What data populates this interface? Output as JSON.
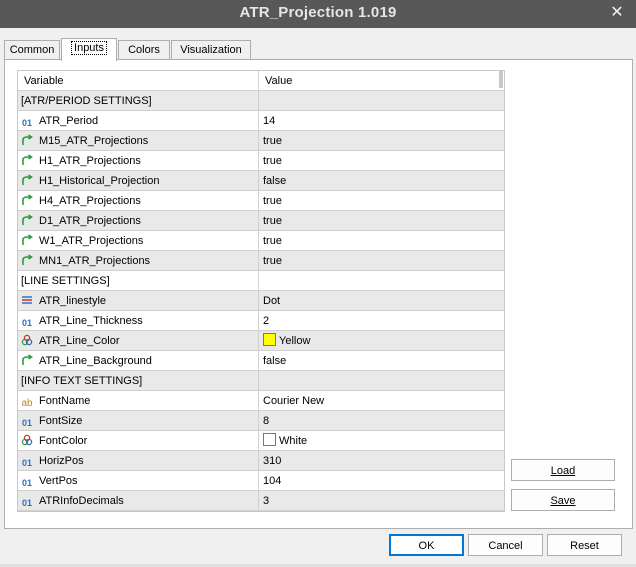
{
  "window": {
    "title": "ATR_Projection 1.019",
    "close_label": "✕"
  },
  "tabs": [
    {
      "label": "Common"
    },
    {
      "label": "Inputs"
    },
    {
      "label": "Colors"
    },
    {
      "label": "Visualization"
    }
  ],
  "grid": {
    "col_variable": "Variable",
    "col_value": "Value",
    "rows": [
      {
        "type": "section",
        "variable": "[ATR/PERIOD SETTINGS]",
        "value": ""
      },
      {
        "type": "int",
        "icon": "integer-icon",
        "variable": "ATR_Period",
        "value": "14"
      },
      {
        "type": "bool",
        "icon": "boolean-icon",
        "variable": "M15_ATR_Projections",
        "value": "true"
      },
      {
        "type": "bool",
        "icon": "boolean-icon",
        "variable": "H1_ATR_Projections",
        "value": "true"
      },
      {
        "type": "bool",
        "icon": "boolean-icon",
        "variable": "H1_Historical_Projection",
        "value": "false"
      },
      {
        "type": "bool",
        "icon": "boolean-icon",
        "variable": "H4_ATR_Projections",
        "value": "true"
      },
      {
        "type": "bool",
        "icon": "boolean-icon",
        "variable": "D1_ATR_Projections",
        "value": "true"
      },
      {
        "type": "bool",
        "icon": "boolean-icon",
        "variable": "W1_ATR_Projections",
        "value": "true"
      },
      {
        "type": "bool",
        "icon": "boolean-icon",
        "variable": "MN1_ATR_Projections",
        "value": "true"
      },
      {
        "type": "section",
        "variable": "[LINE SETTINGS]",
        "value": ""
      },
      {
        "type": "enum",
        "icon": "line-style-icon",
        "variable": "ATR_linestyle",
        "value": "Dot"
      },
      {
        "type": "int",
        "icon": "integer-icon",
        "variable": "ATR_Line_Thickness",
        "value": "2"
      },
      {
        "type": "color",
        "icon": "color-icon",
        "variable": "ATR_Line_Color",
        "value": "Yellow",
        "swatch": "#ffff00"
      },
      {
        "type": "bool",
        "icon": "boolean-icon",
        "variable": "ATR_Line_Background",
        "value": "false"
      },
      {
        "type": "section",
        "variable": "[INFO TEXT SETTINGS]",
        "value": ""
      },
      {
        "type": "string",
        "icon": "string-icon",
        "variable": "FontName",
        "value": "Courier New"
      },
      {
        "type": "int",
        "icon": "integer-icon",
        "variable": "FontSize",
        "value": "8"
      },
      {
        "type": "color",
        "icon": "color-icon",
        "variable": "FontColor",
        "value": "White",
        "swatch": "#ffffff"
      },
      {
        "type": "int",
        "icon": "integer-icon",
        "variable": "HorizPos",
        "value": "310"
      },
      {
        "type": "int",
        "icon": "integer-icon",
        "variable": "VertPos",
        "value": "104"
      },
      {
        "type": "int",
        "icon": "integer-icon",
        "variable": "ATRInfoDecimals",
        "value": "3"
      }
    ]
  },
  "side_buttons": {
    "load": "Load",
    "save": "Save"
  },
  "footer_buttons": {
    "ok": "OK",
    "cancel": "Cancel",
    "reset": "Reset"
  },
  "colors": {
    "titlebar": "#585858",
    "accent": "#0078d7",
    "row_alt": "#e9e9e9"
  }
}
